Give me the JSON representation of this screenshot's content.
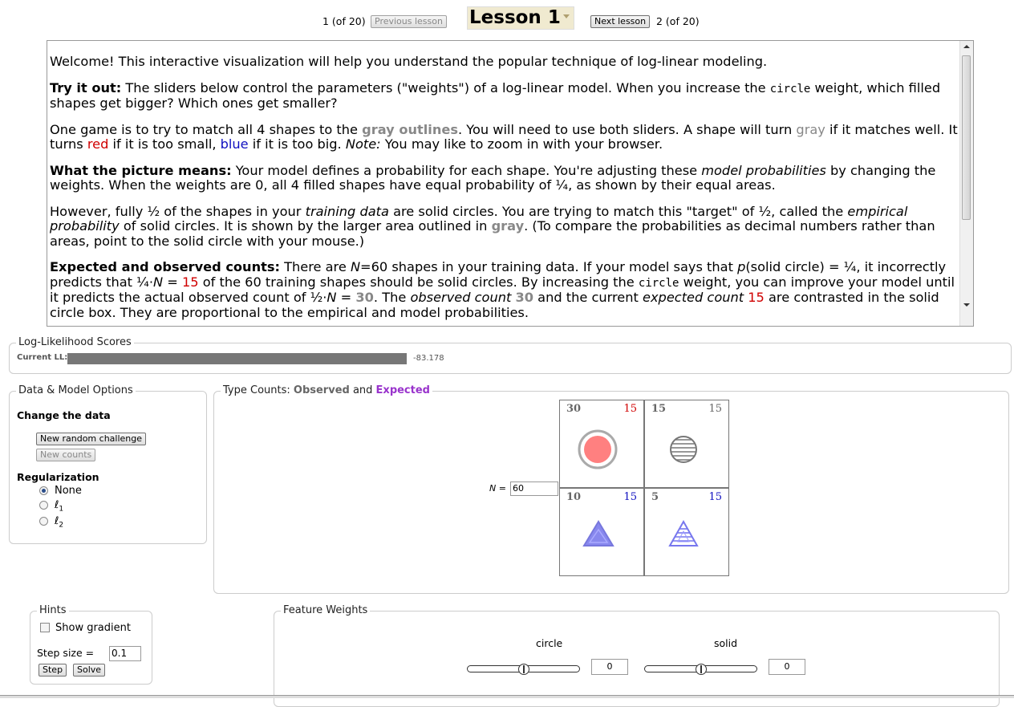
{
  "nav": {
    "prev_index": "1 (of 20)",
    "prev_label": "Previous lesson",
    "title": "Lesson 1",
    "next_label": "Next lesson",
    "next_index": "2 (of 20)"
  },
  "lesson": {
    "p1": "Welcome! This interactive visualization will help you understand the popular technique of log-linear modeling.",
    "p2": {
      "bold": "Try it out:",
      "t1": " The sliders below control the parameters (\"weights\") of a log-linear model. When you increase the ",
      "code": "circle",
      "t2": " weight, which filled shapes get bigger? Which ones get smaller?"
    },
    "p3": {
      "t1": "One game is to try to match all 4 shapes to the ",
      "gray_outlines": "gray outlines",
      "t2": ". You will need to use both sliders. A shape will turn ",
      "gray": "gray",
      "t3": " if it matches well. It turns ",
      "red": "red",
      "t4": " if it is too small, ",
      "blue": "blue",
      "t5": " if it is too big. ",
      "note": "Note:",
      "t6": " You may like to zoom in with your browser."
    },
    "p4": {
      "bold": "What the picture means:",
      "t1": " Your model defines a probability for each shape. You're adjusting these ",
      "em": "model probabilities",
      "t2": " by changing the weights. When the weights are 0, all 4 filled shapes have equal probability of ¼, as shown by their equal areas."
    },
    "p5": {
      "t1": "However, fully ½ of the shapes in your ",
      "em1": "training data",
      "t2": " are solid circles. You are trying to match this \"target\" of ½, called the ",
      "em2": "empirical probability",
      "t3": " of solid circles. It is shown by the larger area outlined in ",
      "gray": "gray",
      "t4": ". (To compare the probabilities as decimal numbers rather than areas, point to the solid circle with your mouse.)"
    },
    "p6": {
      "bold": "Expected and observed counts:",
      "t1": " There are ",
      "N": "N",
      "t2": "=60 shapes in your training data. If your model says that ",
      "p": "p",
      "t3": "(solid circle) = ¼, it incorrectly predicts that ¼·",
      "N2": "N",
      "t4": " = ",
      "red15": "15",
      "t5": " of the 60 training shapes should be solid circles. By increasing the ",
      "code": "circle",
      "t6": " weight, you can improve your model until it predicts the actual observed count of ½·",
      "N3": "N",
      "t7": " = ",
      "gray30": "30",
      "t8": ". The ",
      "em1": "observed count",
      "t9": " ",
      "gray30b": "30",
      "t10": " and the current ",
      "em2": "expected count",
      "t11": " ",
      "red15b": "15",
      "t12": " are contrasted in the solid circle box. They are proportional to the empirical and model probabilities."
    }
  },
  "ll": {
    "legend": "Log-Likelihood Scores",
    "label": "Current LL:",
    "value": "-83.178",
    "bar_fraction": 1.0
  },
  "options": {
    "legend": "Data & Model Options",
    "change_heading": "Change the data",
    "new_challenge": "New random challenge",
    "new_counts": "New counts",
    "reg_heading": "Regularization",
    "reg_none": "None",
    "reg_l1": "ℓ",
    "reg_l1_sub": "1",
    "reg_l2": "ℓ",
    "reg_l2_sub": "2",
    "selected": "None"
  },
  "counts": {
    "legend_prefix": "Type Counts: ",
    "legend_observed": "Observed",
    "legend_and": " and ",
    "legend_expected": "Expected",
    "n_label": "N = ",
    "n_value": "60",
    "cells": [
      {
        "observed": "30",
        "expected": "15",
        "shape": "solid circle",
        "expected_color": "#d00000"
      },
      {
        "observed": "15",
        "expected": "15",
        "shape": "striped circle",
        "expected_color": "#666666"
      },
      {
        "observed": "10",
        "expected": "15",
        "shape": "solid triangle",
        "expected_color": "#1010c0"
      },
      {
        "observed": "5",
        "expected": "15",
        "shape": "striped triangle",
        "expected_color": "#1010c0"
      }
    ]
  },
  "hints": {
    "legend": "Hints",
    "show_gradient": "Show gradient",
    "step_size_label": "Step size = ",
    "step_size_value": "0.1",
    "step": "Step",
    "solve": "Solve"
  },
  "weights": {
    "legend": "Feature Weights",
    "features": [
      {
        "name": "circle",
        "value": "0"
      },
      {
        "name": "solid",
        "value": "0"
      }
    ]
  }
}
